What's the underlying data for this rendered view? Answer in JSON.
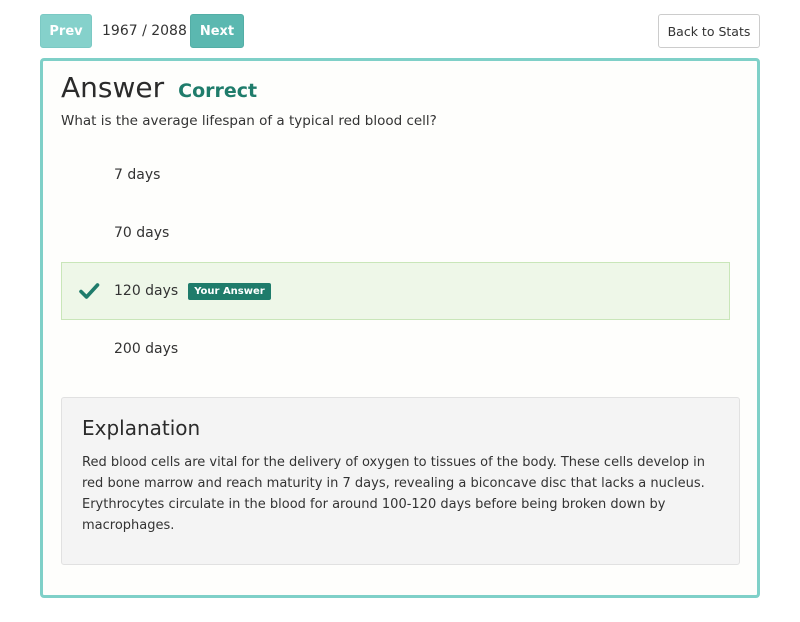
{
  "nav": {
    "prev_label": "Prev",
    "next_label": "Next",
    "counter": "1967 / 2088",
    "back_label": "Back to Stats"
  },
  "card": {
    "title": "Answer",
    "status": "Correct",
    "question": "What is the average lifespan of a typical red blood cell?",
    "options": [
      {
        "label": "7 days",
        "selected": false
      },
      {
        "label": "70 days",
        "selected": false
      },
      {
        "label": "120 days",
        "selected": true,
        "badge": "Your Answer",
        "icon": "check-icon"
      },
      {
        "label": "200 days",
        "selected": false
      }
    ],
    "explanation": {
      "title": "Explanation",
      "text": "Red blood cells are vital for the delivery of oxygen to tissues of the body. These cells develop in red bone marrow and reach maturity in 7 days, revealing a biconcave disc that lacks a nucleus. Erythrocytes circulate in the blood for around 100-120 days before being broken down by macrophages."
    }
  },
  "colors": {
    "accent_teal": "#5bb8b0",
    "card_border": "#7fd0c8",
    "correct_green": "#1f7c6b",
    "selected_bg": "#eef7e8"
  }
}
